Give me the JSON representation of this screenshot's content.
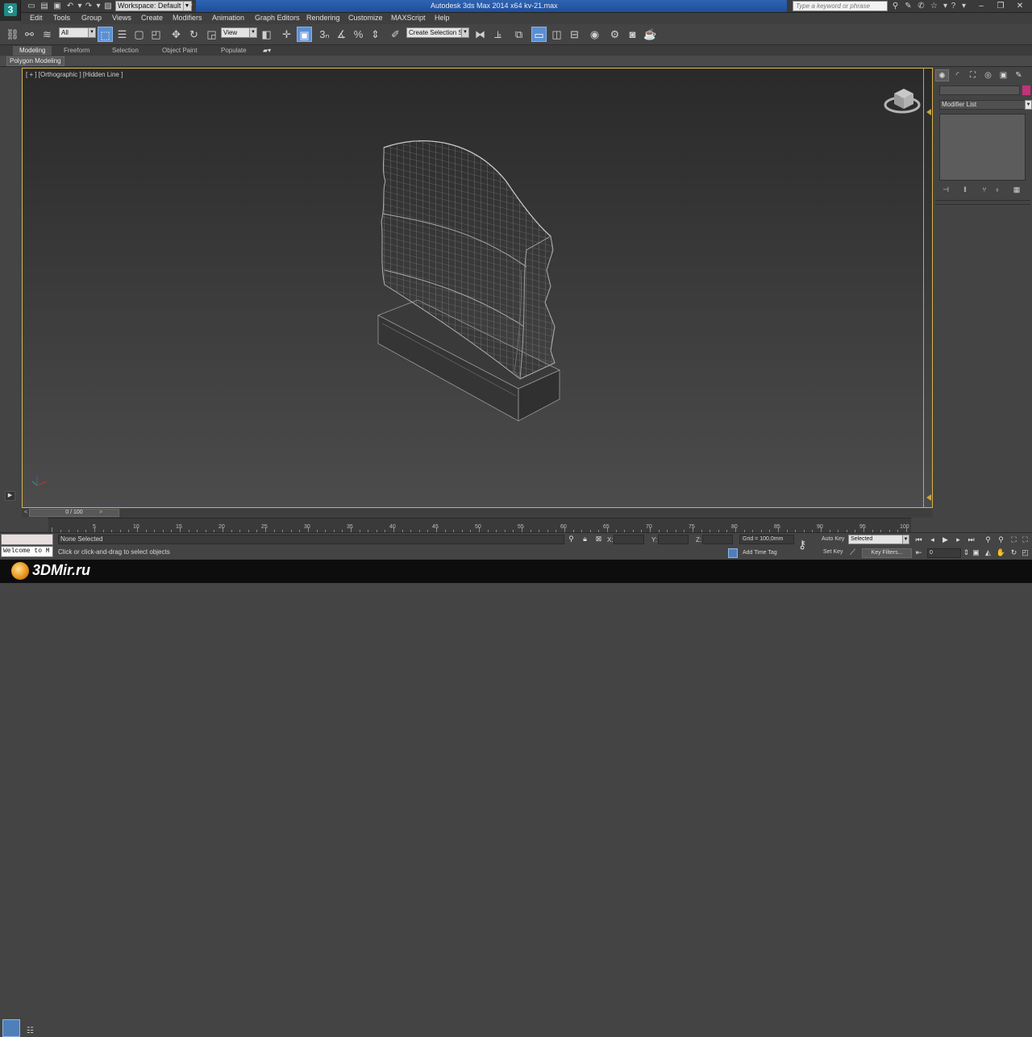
{
  "app": {
    "workspace": "Workspace: Default",
    "title": "Autodesk 3ds Max  2014 x64        kv-21.max",
    "search_placeholder": "Type a keyword or phrase"
  },
  "menu": [
    "Edit",
    "Tools",
    "Group",
    "Views",
    "Create",
    "Modifiers",
    "Animation",
    "Graph Editors",
    "Rendering",
    "Customize",
    "MAXScript",
    "Help"
  ],
  "toolbar": {
    "selection_filter": "All",
    "reference_coord": "View",
    "named_selection": "Create Selection Se"
  },
  "ribbon": {
    "tabs": [
      "Modeling",
      "Freeform",
      "Selection",
      "Object Paint",
      "Populate"
    ],
    "active_tab": "Modeling",
    "panel_label": "Polygon Modeling"
  },
  "viewport": {
    "label": "[ + ] [Orthographic ] [Hidden Line ]",
    "object": "gravestone-wireframe"
  },
  "command_panel": {
    "modifier_list": "Modifier List",
    "object_color": "#c2337a"
  },
  "timeline": {
    "frame_counter": "0 / 100",
    "ticks": [
      5,
      10,
      15,
      20,
      25,
      30,
      35,
      40,
      45,
      50,
      55,
      60,
      65,
      70,
      75,
      80,
      85,
      90,
      95,
      100
    ]
  },
  "status": {
    "welcome": "Welcome to M",
    "selection": "None Selected",
    "prompt": "Click or click-and-drag to select objects",
    "x_label": "X:",
    "y_label": "Y:",
    "z_label": "Z:",
    "grid": "Grid = 100,0mm",
    "add_time_tag": "Add Time Tag",
    "auto_key": "Auto Key",
    "set_key": "Set Key",
    "key_mode": "Selected",
    "key_filters": "Key Filters...",
    "frame": "0"
  },
  "footer": {
    "watermark": "3DMir.ru"
  },
  "colors": {
    "accent": "#5a8fd3",
    "viewport_border": "#d8b24a",
    "title_blue": "#2f64b3"
  }
}
